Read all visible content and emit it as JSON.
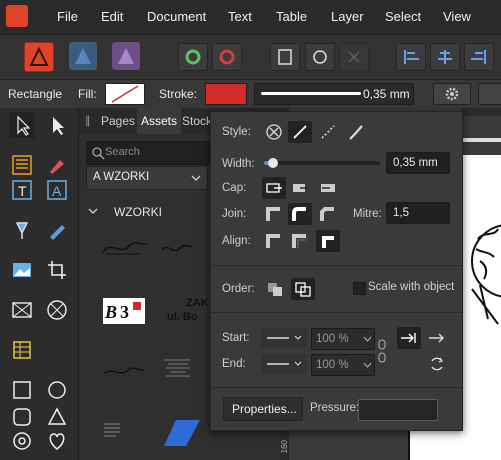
{
  "menu": [
    "File",
    "Edit",
    "Document",
    "Text",
    "Table",
    "Layer",
    "Select",
    "View"
  ],
  "context": {
    "tool_name": "Rectangle",
    "fill_label": "Fill:",
    "stroke_label": "Stroke:",
    "stroke_width": "0,35 mm",
    "stroke_color": "#d42a2a"
  },
  "studio": {
    "tabs": [
      "Pages",
      "Assets",
      "Stock"
    ],
    "search_placeholder": "Search",
    "category": "A WZORKI",
    "section": "WZORKI",
    "asset_texts": {
      "zak": "ZAK",
      "address": "ul. Bo"
    }
  },
  "stroke_popup": {
    "style_label": "Style:",
    "width_label": "Width:",
    "width_value": "0,35 mm",
    "width_fraction": 0.08,
    "cap_label": "Cap:",
    "join_label": "Join:",
    "mitre_label": "Mitre:",
    "mitre_value": "1,5",
    "align_label": "Align:",
    "order_label": "Order:",
    "scale_label": "Scale with object",
    "start_label": "Start:",
    "end_label": "End:",
    "start_scale": "100 %",
    "end_scale": "100 %",
    "properties_button": "Properties...",
    "pressure_label": "Pressure:"
  },
  "ruler_mark": "160",
  "colors": {
    "accent_red": "#e0422a",
    "stroke_red": "#d42a2a",
    "selection_blue": "#2f6bd8"
  }
}
